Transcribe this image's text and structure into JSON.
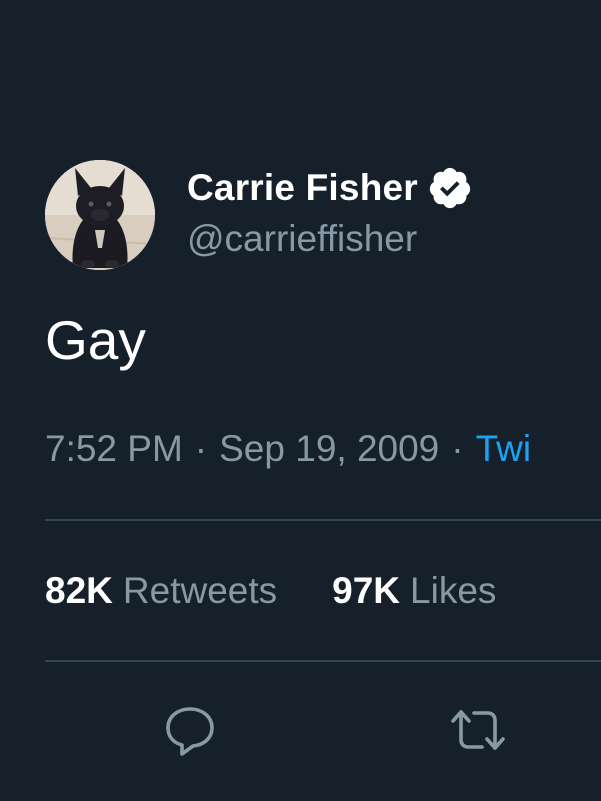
{
  "tweet": {
    "display_name": "Carrie Fisher",
    "handle": "@carrieffisher",
    "text": "Gay",
    "time": "7:52 PM",
    "date": "Sep 19, 2009",
    "separator": "·",
    "source": "Twi",
    "retweets_count": "82K",
    "retweets_label": "Retweets",
    "likes_count": "97K",
    "likes_label": "Likes"
  },
  "icons": {
    "verified": "verified-badge-icon",
    "reply": "reply-icon",
    "retweet": "retweet-icon"
  },
  "colors": {
    "background": "#15202b",
    "primary_text": "#ffffff",
    "secondary_text": "#8899a6",
    "link": "#1da1f2",
    "divider": "#38444d"
  }
}
